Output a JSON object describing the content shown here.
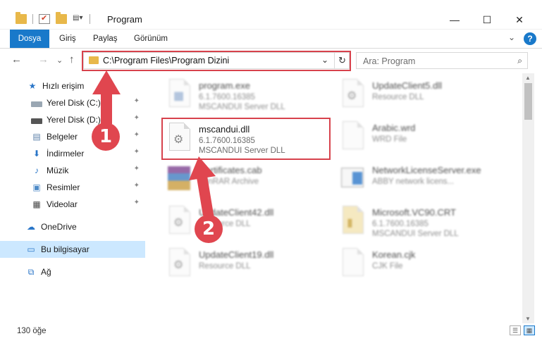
{
  "window": {
    "title": "Program",
    "controls": {
      "minimize": "—",
      "maximize": "☐",
      "close": "✕"
    }
  },
  "ribbon": {
    "tabs": [
      "Dosya",
      "Giriş",
      "Paylaş",
      "Görünüm"
    ],
    "expand": "⌄",
    "help": "?"
  },
  "nav": {
    "back": "←",
    "forward": "→",
    "recent": "⌄",
    "up": "↑",
    "address": "C:\\Program Files\\Program Dizini",
    "address_dropdown": "⌄",
    "refresh": "↻",
    "search_placeholder": "Ara: Program",
    "search_icon": "⌕"
  },
  "sidebar": {
    "items": [
      {
        "label": "Hızlı erişim",
        "icon": "star-icon"
      },
      {
        "label": "Yerel Disk (C:)",
        "icon": "drive-icon",
        "pinned": true
      },
      {
        "label": "Yerel Disk (D:)",
        "icon": "drive-icon",
        "pinned": true
      },
      {
        "label": "Belgeler",
        "icon": "documents-icon",
        "pinned": true
      },
      {
        "label": "İndirmeler",
        "icon": "download-icon",
        "pinned": true
      },
      {
        "label": "Müzik",
        "icon": "music-icon",
        "pinned": true
      },
      {
        "label": "Resimler",
        "icon": "pictures-icon",
        "pinned": true
      },
      {
        "label": "Videolar",
        "icon": "video-icon",
        "pinned": true
      },
      {
        "label": "OneDrive",
        "icon": "cloud-icon"
      },
      {
        "label": "Bu bilgisayar",
        "icon": "computer-icon",
        "selected": true
      },
      {
        "label": "Ağ",
        "icon": "network-icon"
      }
    ],
    "pin_glyph": "📌"
  },
  "files": {
    "left": [
      {
        "name": "program.exe",
        "line1": "6.1.7600.16385",
        "line2": "MSCANDUI Server DLL",
        "blurred": true,
        "icon": "exe-icon"
      },
      {
        "name": "mscandui.dll",
        "line1": "6.1.7600.16385",
        "line2": "MSCANDUI Server DLL",
        "blurred": false,
        "icon": "dll-gear-icon"
      },
      {
        "name": "Certificates.cab",
        "line1": "WinRAR Archive",
        "line2": "",
        "blurred": true,
        "icon": "archive-icon"
      },
      {
        "name": "UpdateClient42.dll",
        "line1": "Resource DLL",
        "line2": "",
        "blurred": true,
        "icon": "dll-gear-icon"
      },
      {
        "name": "UpdateClient19.dll",
        "line1": "Resource DLL",
        "line2": "",
        "blurred": true,
        "icon": "dll-gear-icon"
      }
    ],
    "right": [
      {
        "name": "UpdateClient5.dll",
        "line1": "Resource DLL",
        "line2": "",
        "blurred": true,
        "icon": "dll-gear-icon"
      },
      {
        "name": "Arabic.wrd",
        "line1": "WRD File",
        "line2": "",
        "blurred": true,
        "icon": "file-icon"
      },
      {
        "name": "NetworkLicenseServer.exe",
        "line1": "ABBY network licens...",
        "line2": "",
        "blurred": true,
        "icon": "window-icon"
      },
      {
        "name": "Microsoft.VC90.CRT",
        "line1": "6.1.7600.16385",
        "line2": "MSCANDUI Server DLL",
        "blurred": true,
        "icon": "folder-file-icon"
      },
      {
        "name": "Korean.cjk",
        "line1": "CJK File",
        "line2": "",
        "blurred": true,
        "icon": "file-icon"
      }
    ]
  },
  "status": {
    "count": "130 öğe"
  },
  "annotations": {
    "badge1": "1",
    "badge2": "2",
    "accent": "#d7424c"
  }
}
